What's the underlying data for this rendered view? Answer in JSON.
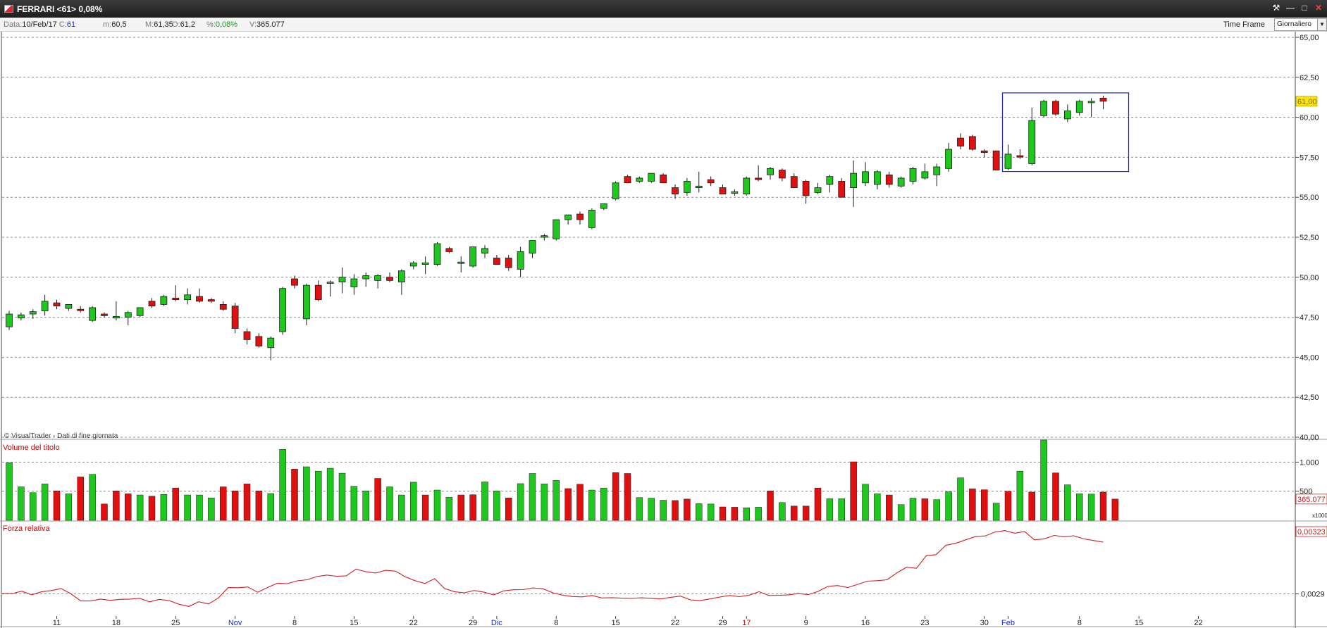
{
  "window": {
    "title": "FERRARI <61> 0,08%"
  },
  "infobar": {
    "date_label": "Data:",
    "date_value": "10/Feb/17",
    "close_label": "C:",
    "close_value": "61",
    "min_label": "m:",
    "min_value": "60,5",
    "max_label": "M:",
    "max_value": "61,35",
    "open_label": "O:",
    "open_value": "61,2",
    "pct_label": "%:",
    "pct_value": "0,08%",
    "vol_label": "V:",
    "vol_value": "365.077",
    "timeframe_label": "Time Frame",
    "timeframe_value": "Giornaliero"
  },
  "panels": {
    "watermark": "© VisualTrader - Dati di fine giornata",
    "volume_title": "Volume del titolo",
    "rs_title": "Forza relativa",
    "volume_unit": "x1000"
  },
  "colors": {
    "up": "#1ec81e",
    "down": "#e01010",
    "wick": "#1a1a1a",
    "grid": "#8a8a8a",
    "rs_line": "#d02020",
    "price_badge": "#ffe600",
    "box": "#2020c0",
    "panel_title": "#cc0000",
    "month_label": "#1a2bd6",
    "year_label": "#cc0000"
  },
  "chart_data": [
    {
      "type": "candlestick",
      "title": "FERRARI <61> 0,08%",
      "ylim": [
        40,
        65
      ],
      "y_ticks": [
        "65,00",
        "62,50",
        "60,00",
        "57,50",
        "55,00",
        "52,50",
        "50,00",
        "47,50",
        "45,00",
        "42,50",
        "40,00"
      ],
      "last_price_label": "61,00",
      "grid": true,
      "x_tick_labels": [
        {
          "label": "11",
          "index": 4,
          "kind": "day"
        },
        {
          "label": "18",
          "index": 9,
          "kind": "day"
        },
        {
          "label": "25",
          "index": 14,
          "kind": "day"
        },
        {
          "label": "Nov",
          "index": 19,
          "kind": "month"
        },
        {
          "label": "8",
          "index": 24,
          "kind": "day"
        },
        {
          "label": "15",
          "index": 29,
          "kind": "day"
        },
        {
          "label": "22",
          "index": 34,
          "kind": "day"
        },
        {
          "label": "29",
          "index": 39,
          "kind": "day"
        },
        {
          "label": "Dic",
          "index": 41,
          "kind": "month"
        },
        {
          "label": "8",
          "index": 46,
          "kind": "day"
        },
        {
          "label": "15",
          "index": 51,
          "kind": "day"
        },
        {
          "label": "22",
          "index": 56,
          "kind": "day"
        },
        {
          "label": "29",
          "index": 60,
          "kind": "day"
        },
        {
          "label": "17",
          "index": 62,
          "kind": "year"
        },
        {
          "label": "9",
          "index": 67,
          "kind": "day"
        },
        {
          "label": "16",
          "index": 72,
          "kind": "day"
        },
        {
          "label": "23",
          "index": 77,
          "kind": "day"
        },
        {
          "label": "30",
          "index": 82,
          "kind": "day"
        },
        {
          "label": "Feb",
          "index": 84,
          "kind": "month"
        },
        {
          "label": "8",
          "index": 90,
          "kind": "day"
        },
        {
          "label": "15",
          "index": 95,
          "kind": "day"
        },
        {
          "label": "22",
          "index": 100,
          "kind": "day"
        }
      ],
      "candles": [
        {
          "o": 46.9,
          "h": 47.9,
          "l": 46.7,
          "c": 47.7
        },
        {
          "o": 47.45,
          "h": 47.8,
          "l": 47.3,
          "c": 47.65
        },
        {
          "o": 47.7,
          "h": 48.0,
          "l": 47.4,
          "c": 47.85
        },
        {
          "o": 47.9,
          "h": 48.9,
          "l": 47.6,
          "c": 48.5
        },
        {
          "o": 48.4,
          "h": 48.6,
          "l": 48.0,
          "c": 48.2
        },
        {
          "o": 48.05,
          "h": 48.3,
          "l": 47.9,
          "c": 48.3
        },
        {
          "o": 48.0,
          "h": 48.2,
          "l": 47.8,
          "c": 47.95
        },
        {
          "o": 47.3,
          "h": 48.2,
          "l": 47.2,
          "c": 48.1
        },
        {
          "o": 47.7,
          "h": 47.8,
          "l": 47.5,
          "c": 47.6
        },
        {
          "o": 47.45,
          "h": 48.5,
          "l": 47.3,
          "c": 47.55
        },
        {
          "o": 47.5,
          "h": 47.9,
          "l": 47.0,
          "c": 47.8
        },
        {
          "o": 47.6,
          "h": 48.1,
          "l": 47.5,
          "c": 48.1
        },
        {
          "o": 48.5,
          "h": 48.7,
          "l": 48.1,
          "c": 48.2
        },
        {
          "o": 48.3,
          "h": 48.9,
          "l": 48.2,
          "c": 48.8
        },
        {
          "o": 48.7,
          "h": 49.5,
          "l": 48.5,
          "c": 48.6
        },
        {
          "o": 48.6,
          "h": 49.3,
          "l": 48.3,
          "c": 48.9
        },
        {
          "o": 48.8,
          "h": 49.3,
          "l": 48.4,
          "c": 48.5
        },
        {
          "o": 48.6,
          "h": 48.7,
          "l": 48.4,
          "c": 48.5
        },
        {
          "o": 48.3,
          "h": 48.5,
          "l": 47.9,
          "c": 48.0
        },
        {
          "o": 48.2,
          "h": 48.4,
          "l": 46.5,
          "c": 46.8
        },
        {
          "o": 46.6,
          "h": 46.8,
          "l": 45.8,
          "c": 46.1
        },
        {
          "o": 46.3,
          "h": 46.5,
          "l": 45.6,
          "c": 45.7
        },
        {
          "o": 45.6,
          "h": 46.3,
          "l": 44.8,
          "c": 46.2
        },
        {
          "o": 46.6,
          "h": 49.4,
          "l": 46.4,
          "c": 49.3
        },
        {
          "o": 49.9,
          "h": 50.1,
          "l": 49.3,
          "c": 49.5
        },
        {
          "o": 47.4,
          "h": 49.6,
          "l": 47.0,
          "c": 49.5
        },
        {
          "o": 49.5,
          "h": 49.8,
          "l": 48.5,
          "c": 48.6
        },
        {
          "o": 49.7,
          "h": 49.8,
          "l": 48.8,
          "c": 49.7
        },
        {
          "o": 49.7,
          "h": 50.6,
          "l": 49.0,
          "c": 50.0
        },
        {
          "o": 49.4,
          "h": 50.2,
          "l": 48.9,
          "c": 49.9
        },
        {
          "o": 49.9,
          "h": 50.3,
          "l": 49.4,
          "c": 50.1
        },
        {
          "o": 49.8,
          "h": 50.2,
          "l": 49.3,
          "c": 50.1
        },
        {
          "o": 50.0,
          "h": 50.3,
          "l": 49.7,
          "c": 49.8
        },
        {
          "o": 49.7,
          "h": 50.5,
          "l": 48.9,
          "c": 50.4
        },
        {
          "o": 50.7,
          "h": 51.0,
          "l": 50.5,
          "c": 50.9
        },
        {
          "o": 50.8,
          "h": 51.3,
          "l": 50.2,
          "c": 50.9
        },
        {
          "o": 50.8,
          "h": 52.2,
          "l": 50.7,
          "c": 52.1
        },
        {
          "o": 51.8,
          "h": 51.9,
          "l": 51.5,
          "c": 51.6
        },
        {
          "o": 50.9,
          "h": 51.3,
          "l": 50.3,
          "c": 50.95
        },
        {
          "o": 50.7,
          "h": 51.9,
          "l": 50.6,
          "c": 51.9
        },
        {
          "o": 51.5,
          "h": 52.0,
          "l": 51.2,
          "c": 51.8
        },
        {
          "o": 51.2,
          "h": 51.4,
          "l": 50.8,
          "c": 50.8
        },
        {
          "o": 51.2,
          "h": 51.4,
          "l": 50.4,
          "c": 50.6
        },
        {
          "o": 50.5,
          "h": 51.9,
          "l": 50.0,
          "c": 51.6
        },
        {
          "o": 51.5,
          "h": 52.3,
          "l": 51.2,
          "c": 52.3
        },
        {
          "o": 52.5,
          "h": 52.7,
          "l": 52.3,
          "c": 52.6
        },
        {
          "o": 52.4,
          "h": 53.6,
          "l": 52.3,
          "c": 53.6
        },
        {
          "o": 53.6,
          "h": 53.9,
          "l": 53.3,
          "c": 53.9
        },
        {
          "o": 53.95,
          "h": 54.1,
          "l": 53.3,
          "c": 53.6
        },
        {
          "o": 53.1,
          "h": 54.3,
          "l": 53.0,
          "c": 54.2
        },
        {
          "o": 54.3,
          "h": 54.6,
          "l": 54.2,
          "c": 54.6
        },
        {
          "o": 54.9,
          "h": 56.0,
          "l": 54.8,
          "c": 55.9
        },
        {
          "o": 56.3,
          "h": 56.4,
          "l": 56.0,
          "c": 55.9
        },
        {
          "o": 56.0,
          "h": 56.3,
          "l": 55.9,
          "c": 56.2
        },
        {
          "o": 56.0,
          "h": 56.5,
          "l": 55.9,
          "c": 56.5
        },
        {
          "o": 56.4,
          "h": 56.5,
          "l": 55.9,
          "c": 55.9
        },
        {
          "o": 55.6,
          "h": 55.8,
          "l": 54.9,
          "c": 55.2
        },
        {
          "o": 55.3,
          "h": 56.2,
          "l": 55.1,
          "c": 56.0
        },
        {
          "o": 55.6,
          "h": 56.6,
          "l": 55.3,
          "c": 55.7
        },
        {
          "o": 56.1,
          "h": 56.3,
          "l": 55.7,
          "c": 55.9
        },
        {
          "o": 55.6,
          "h": 55.8,
          "l": 55.2,
          "c": 55.2
        },
        {
          "o": 55.25,
          "h": 55.5,
          "l": 55.1,
          "c": 55.35
        },
        {
          "o": 55.2,
          "h": 56.3,
          "l": 55.1,
          "c": 56.2
        },
        {
          "o": 56.2,
          "h": 57.0,
          "l": 56.0,
          "c": 56.1
        },
        {
          "o": 56.4,
          "h": 56.9,
          "l": 56.1,
          "c": 56.8
        },
        {
          "o": 56.7,
          "h": 56.8,
          "l": 56.0,
          "c": 56.2
        },
        {
          "o": 56.3,
          "h": 56.5,
          "l": 55.6,
          "c": 55.6
        },
        {
          "o": 56.0,
          "h": 56.1,
          "l": 54.6,
          "c": 55.1
        },
        {
          "o": 55.3,
          "h": 55.9,
          "l": 55.2,
          "c": 55.6
        },
        {
          "o": 55.8,
          "h": 56.4,
          "l": 55.3,
          "c": 56.3
        },
        {
          "o": 56.0,
          "h": 56.2,
          "l": 55.0,
          "c": 55.0
        },
        {
          "o": 55.6,
          "h": 57.3,
          "l": 54.4,
          "c": 56.5
        },
        {
          "o": 55.9,
          "h": 57.2,
          "l": 55.7,
          "c": 56.6
        },
        {
          "o": 55.8,
          "h": 56.7,
          "l": 55.5,
          "c": 56.6
        },
        {
          "o": 56.4,
          "h": 56.6,
          "l": 55.6,
          "c": 55.8
        },
        {
          "o": 55.7,
          "h": 56.3,
          "l": 55.6,
          "c": 56.2
        },
        {
          "o": 56.0,
          "h": 56.9,
          "l": 55.8,
          "c": 56.8
        },
        {
          "o": 56.2,
          "h": 57.1,
          "l": 56.1,
          "c": 56.6
        },
        {
          "o": 56.4,
          "h": 57.1,
          "l": 55.7,
          "c": 56.9
        },
        {
          "o": 56.8,
          "h": 58.4,
          "l": 56.6,
          "c": 58.0
        },
        {
          "o": 58.7,
          "h": 59.0,
          "l": 58.0,
          "c": 58.2
        },
        {
          "o": 58.8,
          "h": 58.9,
          "l": 57.9,
          "c": 58.0
        },
        {
          "o": 57.9,
          "h": 58.0,
          "l": 57.5,
          "c": 57.8
        },
        {
          "o": 57.9,
          "h": 57.9,
          "l": 56.7,
          "c": 56.7
        },
        {
          "o": 56.8,
          "h": 58.3,
          "l": 56.7,
          "c": 57.7
        },
        {
          "o": 57.6,
          "h": 58.0,
          "l": 57.4,
          "c": 57.55
        },
        {
          "o": 57.1,
          "h": 60.6,
          "l": 57.0,
          "c": 59.8
        },
        {
          "o": 60.1,
          "h": 61.1,
          "l": 60.0,
          "c": 61.0
        },
        {
          "o": 61.0,
          "h": 61.1,
          "l": 60.1,
          "c": 60.2
        },
        {
          "o": 59.9,
          "h": 60.8,
          "l": 59.7,
          "c": 60.4
        },
        {
          "o": 60.3,
          "h": 61.1,
          "l": 60.1,
          "c": 61.0
        },
        {
          "o": 60.95,
          "h": 61.2,
          "l": 60.0,
          "c": 61.0
        },
        {
          "o": 61.2,
          "h": 61.35,
          "l": 60.5,
          "c": 61.0
        }
      ]
    },
    {
      "type": "bar",
      "title": "Volume del titolo",
      "unit": "x1000",
      "ylim": [
        0,
        1380
      ],
      "y_ticks": [
        "1.000",
        "500"
      ],
      "last_value_label": "365.077",
      "values": [
        990,
        575,
        475,
        625,
        505,
        455,
        745,
        790,
        280,
        505,
        455,
        435,
        415,
        445,
        555,
        435,
        435,
        385,
        575,
        505,
        625,
        505,
        460,
        1220,
        880,
        920,
        845,
        895,
        810,
        585,
        505,
        720,
        575,
        435,
        655,
        435,
        520,
        395,
        435,
        440,
        660,
        505,
        385,
        630,
        805,
        625,
        685,
        545,
        620,
        520,
        555,
        820,
        805,
        390,
        380,
        345,
        340,
        365,
        285,
        280,
        230,
        225,
        215,
        225,
        505,
        305,
        245,
        245,
        555,
        370,
        370,
        1005,
        620,
        455,
        435,
        270,
        380,
        370,
        355,
        490,
        730,
        540,
        525,
        295,
        500,
        845,
        485,
        1380,
        815,
        610,
        455,
        450,
        485,
        365
      ],
      "colors": [
        "g",
        "g",
        "g",
        "g",
        "r",
        "g",
        "r",
        "g",
        "r",
        "r",
        "r",
        "g",
        "r",
        "g",
        "r",
        "g",
        "g",
        "g",
        "r",
        "r",
        "r",
        "r",
        "g",
        "g",
        "r",
        "g",
        "g",
        "g",
        "g",
        "g",
        "g",
        "r",
        "g",
        "g",
        "g",
        "r",
        "g",
        "g",
        "r",
        "r",
        "g",
        "g",
        "r",
        "g",
        "g",
        "g",
        "g",
        "r",
        "r",
        "g",
        "g",
        "r",
        "r",
        "g",
        "g",
        "g",
        "r",
        "r",
        "g",
        "g",
        "r",
        "r",
        "g",
        "g",
        "r",
        "g",
        "r",
        "r",
        "r",
        "g",
        "g",
        "r",
        "g",
        "g",
        "r",
        "g",
        "g",
        "r",
        "g",
        "g",
        "g",
        "r",
        "r",
        "g",
        "r",
        "g",
        "r",
        "g",
        "r",
        "g",
        "g",
        "g",
        "r",
        "r"
      ]
    },
    {
      "type": "line",
      "title": "Forza relativa",
      "last_value_label": "0,00323",
      "y_ticks": [
        "0,0029"
      ],
      "values": [
        0.002902,
        0.002902,
        0.002917,
        0.002894,
        0.002913,
        0.002921,
        0.002934,
        0.0029,
        0.002855,
        0.002855,
        0.002867,
        0.002859,
        0.002865,
        0.002867,
        0.002872,
        0.002849,
        0.002865,
        0.002857,
        0.002834,
        0.00282,
        0.00285,
        0.002836,
        0.002874,
        0.00294,
        0.002939,
        0.002944,
        0.00291,
        0.002941,
        0.002968,
        0.002965,
        0.002983,
        0.00299,
        0.00301,
        0.00302,
        0.003012,
        0.003015,
        0.003058,
        0.003041,
        0.003033,
        0.00305,
        0.003045,
        0.003009,
        0.002984,
        0.002966,
        0.002997,
        0.002934,
        0.002914,
        0.002907,
        0.002921,
        0.002911,
        0.002894,
        0.002919,
        0.002926,
        0.002927,
        0.002938,
        0.002933,
        0.002907,
        0.002892,
        0.002883,
        0.002881,
        0.00289,
        0.002874,
        0.002876,
        0.002873,
        0.002871,
        0.002875,
        0.002872,
        0.002868,
        0.002878,
        0.002886,
        0.002862,
        0.002857,
        0.002868,
        0.00288,
        0.00289,
        0.002882,
        0.002892,
        0.002914,
        0.00289,
        0.002891,
        0.002894,
        0.002902,
        0.002895,
        0.002916,
        0.002948,
        0.002953,
        0.00294,
        0.00296,
        0.002981,
        0.002984,
        0.00299,
        0.003033,
        0.00307,
        0.003063,
        0.003143,
        0.00315,
        0.00321,
        0.003222,
        0.003244,
        0.003265,
        0.003269,
        0.003294,
        0.003303,
        0.003286,
        0.003297,
        0.003244,
        0.00325,
        0.003272,
        0.003264,
        0.00327,
        0.00325,
        0.00324,
        0.00323
      ]
    }
  ]
}
